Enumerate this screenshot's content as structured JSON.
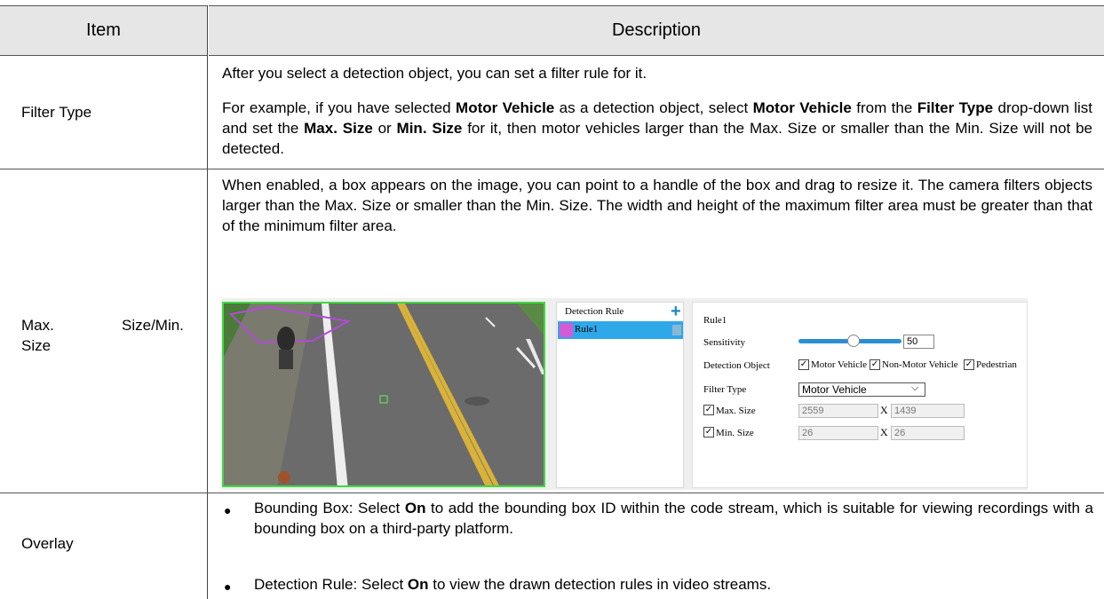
{
  "table": {
    "headers": {
      "item": "Item",
      "description": "Description"
    },
    "rows": [
      {
        "item": "Filter Type",
        "p1": "After you select a detection object, you can set a filter rule for it.",
        "p2": {
          "a": "For example, if you have selected ",
          "b": "Motor Vehicle",
          "c": " as a detection object, select ",
          "d": "Motor Vehicle",
          "e": " from the ",
          "f": "Filter Type",
          "g": " drop-down list and set the ",
          "h": "Max. Size",
          "i": " or ",
          "j": "Min. Size",
          "k": " for it, then motor vehicles larger than the Max. Size or smaller than the Min. Size will not be detected."
        }
      },
      {
        "item_line1_a": "Max.",
        "item_line1_b": "Size/Min.",
        "item_line2": "Size",
        "p1": "When enabled, a box appears on the image, you can point to a handle of the box and drag to resize it. The camera filters objects larger than the Max. Size or smaller than the Min. Size. The width and height of the maximum filter area must be greater than that of the minimum filter area."
      },
      {
        "item": "Overlay",
        "bullets": [
          {
            "label": "Bounding Box: Select ",
            "bold": "On",
            "rest": " to add the bounding box ID within the code stream, which is suitable for viewing recordings with a bounding box on a third-party platform."
          },
          {
            "label": "Detection Rule: Select ",
            "bold": "On",
            "rest": " to view the drawn detection rules in video streams."
          }
        ]
      }
    ]
  },
  "screenshot": {
    "rule_list_title": "Detection Rule",
    "rule_item": "Rule1",
    "panel_title": "Rule1",
    "sensitivity_label": "Sensitivity",
    "sensitivity_value": "50",
    "sensitivity_fraction": 0.5,
    "detection_object_label": "Detection Object",
    "objects": [
      "Motor Vehicle",
      "Non-Motor Vehicle",
      "Pedestrian"
    ],
    "filter_type_label": "Filter Type",
    "filter_type_value": "Motor Vehicle",
    "max_size_label": "Max. Size",
    "max_w": "2559",
    "max_h": "1439",
    "min_size_label": "Min. Size",
    "min_w": "26",
    "min_h": "26",
    "x_sep": "X",
    "colors": {
      "accent": "#2ea8e8",
      "video_border": "#3fdb3f",
      "rule_swatch": "#d45bd6"
    }
  }
}
